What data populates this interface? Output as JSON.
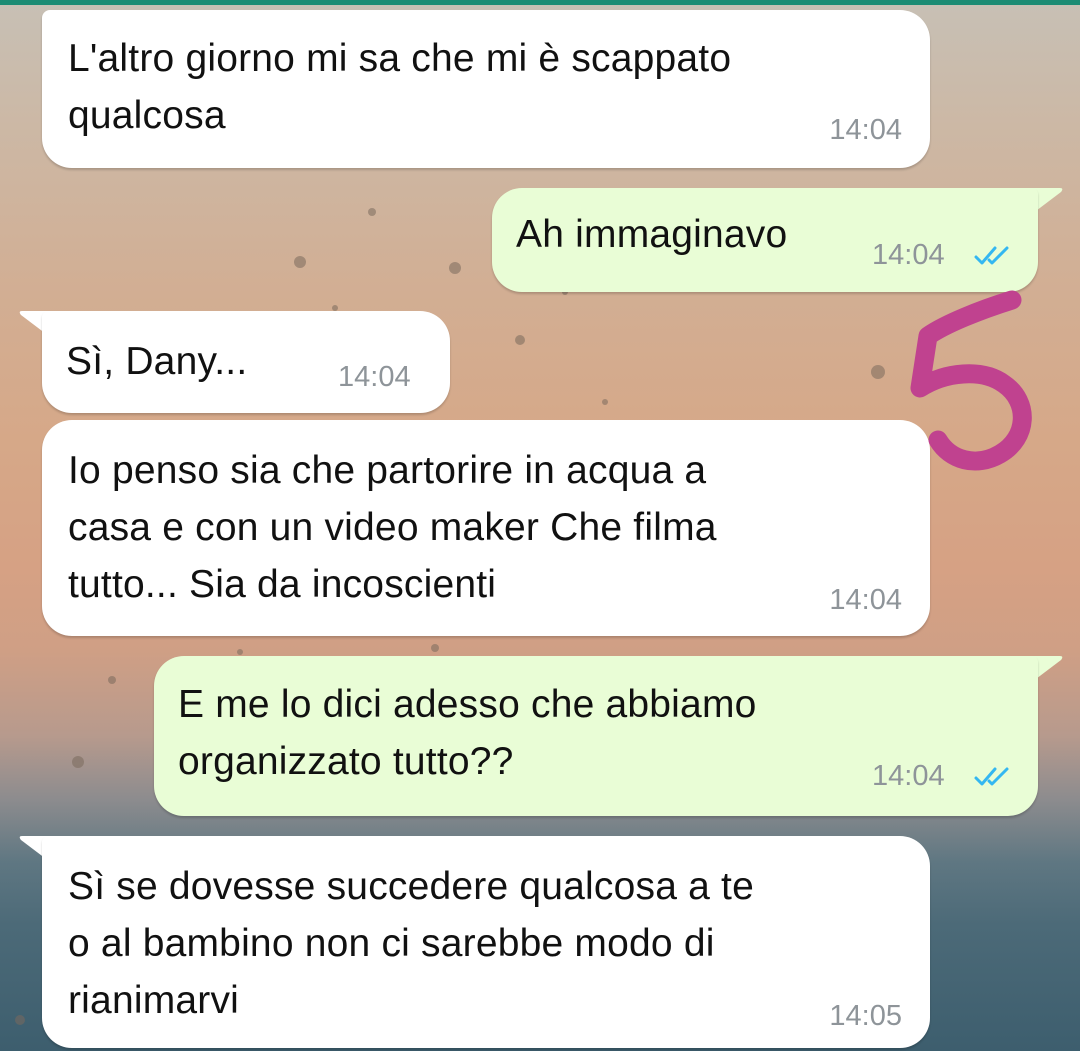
{
  "messages": [
    {
      "direction": "incoming",
      "text": "L'altro giorno mi sa che mi è scappato\nqualcosa",
      "time": "14:04"
    },
    {
      "direction": "outgoing",
      "text": "Ah immaginavo",
      "time": "14:04",
      "status": "read"
    },
    {
      "direction": "incoming",
      "text": "Sì, Dany...",
      "time": "14:04"
    },
    {
      "direction": "incoming",
      "text": "Io penso sia che partorire in acqua a\ncasa e con un video maker Che filma\ntutto... Sia da incoscienti",
      "time": "14:04"
    },
    {
      "direction": "outgoing",
      "text": "E me lo dici adesso che abbiamo\norganizzato tutto??",
      "time": "14:04",
      "status": "read"
    },
    {
      "direction": "incoming",
      "text": "Sì se dovesse succedere qualcosa a te\no al bambino non ci sarebbe modo di\nrianimarvi",
      "time": "14:05"
    }
  ],
  "annotation": {
    "text": "5",
    "color": "#c0428f"
  },
  "colors": {
    "incoming_bubble": "#ffffff",
    "outgoing_bubble": "#e9fdd6",
    "read_ticks": "#34b7f1",
    "timestamp": "#8e9499",
    "top_bar": "#1c8c74"
  },
  "icons": {
    "read_receipt": "double-check-icon"
  }
}
